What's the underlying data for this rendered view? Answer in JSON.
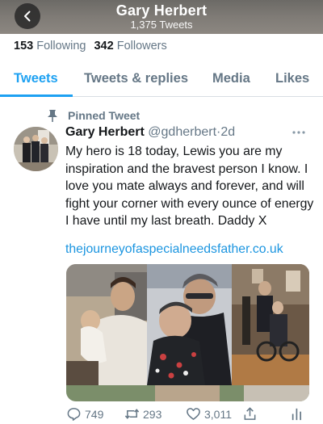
{
  "header": {
    "name": "Gary Herbert",
    "tweet_count": "1,375 Tweets"
  },
  "profile": {
    "following_count": "153",
    "following_label": "Following",
    "followers_count": "342",
    "followers_label": "Followers"
  },
  "tabs": [
    {
      "label": "Tweets",
      "active": true
    },
    {
      "label": "Tweets & replies",
      "active": false
    },
    {
      "label": "Media",
      "active": false
    },
    {
      "label": "Likes",
      "active": false
    }
  ],
  "tweet": {
    "pinned_label": "Pinned Tweet",
    "author_name": "Gary Herbert",
    "handle": "@gdherbert",
    "separator": "·",
    "time": "2d",
    "text": "My hero is 18 today, Lewis you are my inspiration and the bravest person I know.  I love you mate always and forever, and will fight your corner with every ounce of energy I have until my last breath. Daddy X",
    "link": "thejourneyofaspecialneedsfather.co.uk",
    "replies": "749",
    "retweets": "293",
    "likes": "3,011"
  },
  "colors": {
    "accent": "#1da1f2",
    "link": "#1b95e0",
    "muted": "#657786",
    "text": "#14171a"
  },
  "icons": [
    "back-arrow-icon",
    "pin-icon",
    "more-options-icon",
    "reply-icon",
    "retweet-icon",
    "like-icon",
    "share-icon",
    "analytics-icon"
  ]
}
